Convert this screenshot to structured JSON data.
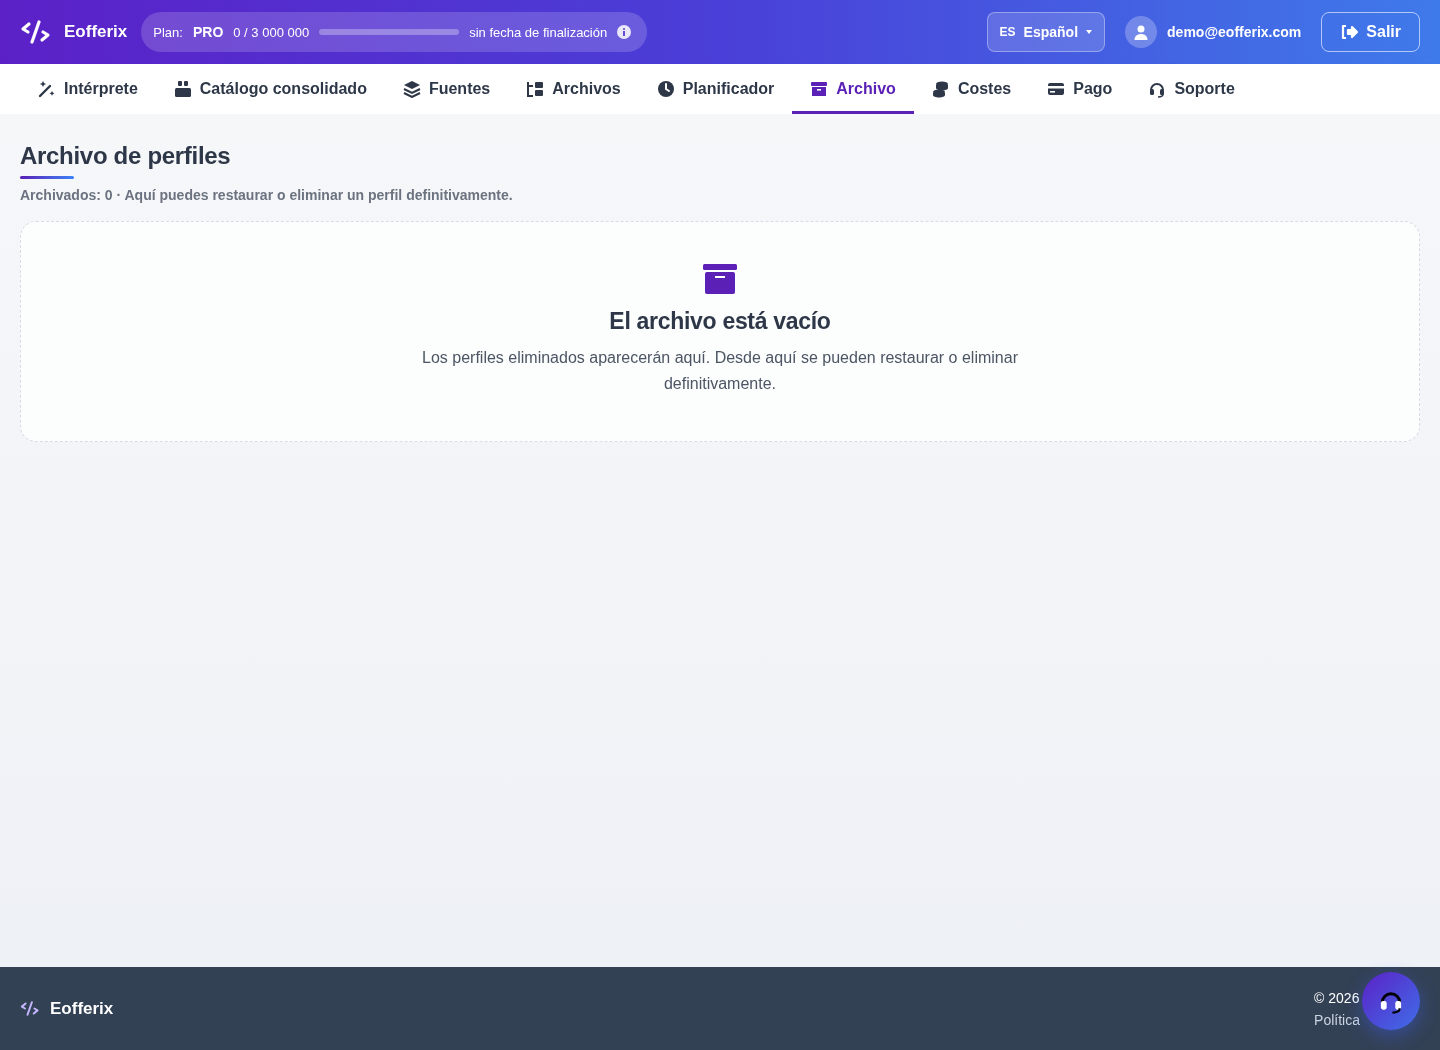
{
  "header": {
    "brand": "Eofferix",
    "plan": {
      "label": "Plan:",
      "name": "PRO",
      "usage": "0 / 3 000 000",
      "level": 0,
      "expiry": "sin fecha de finalización"
    },
    "language": {
      "code": "ES",
      "name": "Español"
    },
    "user": "demo@eofferix.com",
    "logout": "Salir"
  },
  "tabs": [
    {
      "label": "Intérprete",
      "selected": false
    },
    {
      "label": "Catálogo consolidado",
      "selected": false
    },
    {
      "label": "Fuentes",
      "selected": false
    },
    {
      "label": "Archivos",
      "selected": false
    },
    {
      "label": "Planificador",
      "selected": false
    },
    {
      "label": "Archivo",
      "selected": true
    },
    {
      "label": "Costes",
      "selected": false
    },
    {
      "label": "Pago",
      "selected": false
    },
    {
      "label": "Soporte",
      "selected": false
    }
  ],
  "page": {
    "title": "Archivo de perfiles",
    "subtitle": "Archivados: 0 · Aquí puedes restaurar o eliminar un perfil definitivamente."
  },
  "empty_state": {
    "title": "El archivo está vacío",
    "text": "Los perfiles eliminados aparecerán aquí. Desde aquí se pueden restaurar o eliminar definitivamente."
  },
  "footer": {
    "brand": "Eofferix",
    "copyright": "© 2026",
    "link": "Política"
  }
}
